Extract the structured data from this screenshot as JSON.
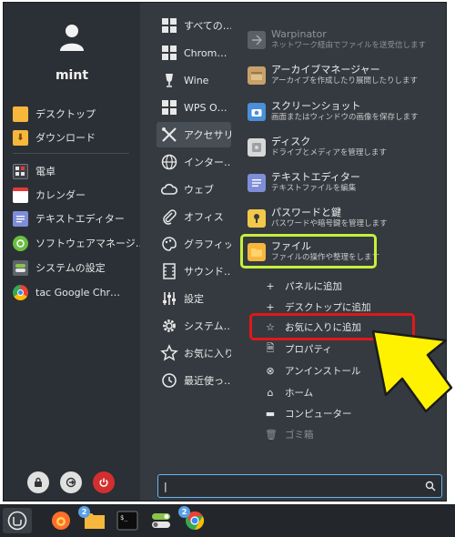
{
  "user": {
    "name": "mint"
  },
  "favorites": [
    {
      "label": "デスクトップ",
      "icon": "folder-icon",
      "color": "#f6b73c"
    },
    {
      "label": "ダウンロード",
      "icon": "download-folder-icon",
      "color": "#f6b73c"
    },
    {
      "label": "電卓",
      "icon": "calculator-icon",
      "color": "#444a52"
    },
    {
      "label": "カレンダー",
      "icon": "calendar-icon",
      "color": "#ffffff"
    },
    {
      "label": "テキストエディター",
      "icon": "text-editor-icon",
      "color": "#7e8ed8"
    },
    {
      "label": "ソフトウェアマネージ…",
      "icon": "software-manager-icon",
      "color": "#6abf40"
    },
    {
      "label": "システムの設定",
      "icon": "system-settings-icon",
      "color": "#8bc34a"
    },
    {
      "label": "tac Google Chr…",
      "icon": "chrome-icon",
      "color": "#ea4335"
    }
  ],
  "categories": [
    "すべての…",
    "Chrom…",
    "Wine",
    "WPS O…",
    "アクセサリ",
    "インター…",
    "ウェブ",
    "オフィス",
    "グラフィッ…",
    "サウンド…",
    "設定",
    "システム…",
    "お気に入り",
    "最近使っ…"
  ],
  "apps": [
    {
      "name": "Warpinator",
      "desc": "ネットワーク経由でファイルを送受信します",
      "dim": true
    },
    {
      "name": "アーカイブマネージャー",
      "desc": "アーカイブを作成したり展開したりします"
    },
    {
      "name": "スクリーンショット",
      "desc": "画面またはウィンドウの画像を保存します"
    },
    {
      "name": "ディスク",
      "desc": "ドライブとメディアを管理します"
    },
    {
      "name": "テキストエディター",
      "desc": "テキストファイルを編集"
    },
    {
      "name": "パスワードと鍵",
      "desc": "パスワードや暗号鍵を管理します"
    },
    {
      "name": "ファイル",
      "desc": "ファイルの操作や整理をします"
    }
  ],
  "context_menu": [
    {
      "label": "パネルに追加",
      "icon": "plus-icon"
    },
    {
      "label": "デスクトップに追加",
      "icon": "plus-icon"
    },
    {
      "label": "お気に入りに追加",
      "icon": "star-icon"
    },
    {
      "label": "プロパティ",
      "icon": "properties-icon"
    },
    {
      "label": "アンインストール",
      "icon": "uninstall-icon"
    },
    {
      "label": "ホーム",
      "icon": "home-icon"
    },
    {
      "label": "コンピューター",
      "icon": "computer-icon"
    },
    {
      "label": "ゴミ箱",
      "icon": "trash-icon",
      "dim": true
    }
  ],
  "search": {
    "value": "|"
  },
  "panel": {
    "badges": [
      "2",
      "2"
    ]
  },
  "colors": {
    "highlight_green": "#c6f03b",
    "highlight_red": "#e01818",
    "arrow": "#fff200"
  }
}
